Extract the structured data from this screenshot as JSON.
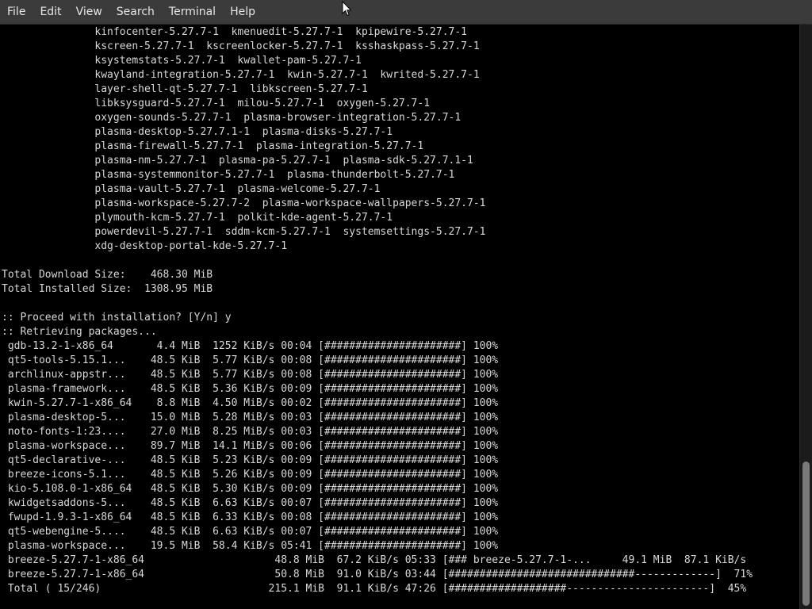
{
  "menu": [
    "File",
    "Edit",
    "View",
    "Search",
    "Terminal",
    "Help"
  ],
  "terminal_lines": [
    "               kinfocenter-5.27.7-1  kmenuedit-5.27.7-1  kpipewire-5.27.7-1",
    "               kscreen-5.27.7-1  kscreenlocker-5.27.7-1  ksshaskpass-5.27.7-1",
    "               ksystemstats-5.27.7-1  kwallet-pam-5.27.7-1",
    "               kwayland-integration-5.27.7-1  kwin-5.27.7-1  kwrited-5.27.7-1",
    "               layer-shell-qt-5.27.7-1  libkscreen-5.27.7-1",
    "               libksysguard-5.27.7-1  milou-5.27.7-1  oxygen-5.27.7-1",
    "               oxygen-sounds-5.27.7-1  plasma-browser-integration-5.27.7-1",
    "               plasma-desktop-5.27.7.1-1  plasma-disks-5.27.7-1",
    "               plasma-firewall-5.27.7-1  plasma-integration-5.27.7-1",
    "               plasma-nm-5.27.7-1  plasma-pa-5.27.7-1  plasma-sdk-5.27.7.1-1",
    "               plasma-systemmonitor-5.27.7-1  plasma-thunderbolt-5.27.7-1",
    "               plasma-vault-5.27.7-1  plasma-welcome-5.27.7-1",
    "               plasma-workspace-5.27.7-2  plasma-workspace-wallpapers-5.27.7-1",
    "               plymouth-kcm-5.27.7-1  polkit-kde-agent-5.27.7-1",
    "               powerdevil-5.27.7-1  sddm-kcm-5.27.7-1  systemsettings-5.27.7-1",
    "               xdg-desktop-portal-kde-5.27.7-1",
    "",
    "Total Download Size:    468.30 MiB",
    "Total Installed Size:  1308.95 MiB",
    "",
    ":: Proceed with installation? [Y/n] y",
    ":: Retrieving packages...",
    " gdb-13.2-1-x86_64       4.4 MiB  1252 KiB/s 00:04 [######################] 100%",
    " qt5-tools-5.15.1...    48.5 KiB  5.77 KiB/s 00:08 [######################] 100%",
    " archlinux-appstr...    48.5 KiB  5.77 KiB/s 00:08 [######################] 100%",
    " plasma-framework...    48.5 KiB  5.36 KiB/s 00:09 [######################] 100%",
    " kwin-5.27.7-1-x86_64    8.8 MiB  4.50 MiB/s 00:02 [######################] 100%",
    " plasma-desktop-5...    15.0 MiB  5.28 MiB/s 00:03 [######################] 100%",
    " noto-fonts-1:23....    27.0 MiB  8.25 MiB/s 00:03 [######################] 100%",
    " plasma-workspace...    89.7 MiB  14.1 MiB/s 00:06 [######################] 100%",
    " qt5-declarative-...    48.5 KiB  5.23 KiB/s 00:09 [######################] 100%",
    " breeze-icons-5.1...    48.5 KiB  5.26 KiB/s 00:09 [######################] 100%",
    " kio-5.108.0-1-x86_64   48.5 KiB  5.30 KiB/s 00:09 [######################] 100%",
    " kwidgetsaddons-5...    48.5 KiB  6.63 KiB/s 00:07 [######################] 100%",
    " fwupd-1.9.3-1-x86_64   48.5 KiB  6.33 KiB/s 00:08 [######################] 100%",
    " qt5-webengine-5....    48.5 KiB  6.63 KiB/s 00:07 [######################] 100%",
    " plasma-workspace...    19.5 MiB  58.4 KiB/s 05:41 [######################] 100%",
    " breeze-5.27.7-1-x86_64                     48.8 MiB  67.2 KiB/s 05:33 [### breeze-5.27.7-1-...     49.1 MiB  87.1 KiB/s",
    " breeze-5.27.7-1-x86_64                     50.8 MiB  91.0 KiB/s 03:44 [##############################-------------]  71%",
    " Total ( 15/246)                           215.1 MiB  91.1 KiB/s 47:26 [###################-----------------------]  45%"
  ]
}
